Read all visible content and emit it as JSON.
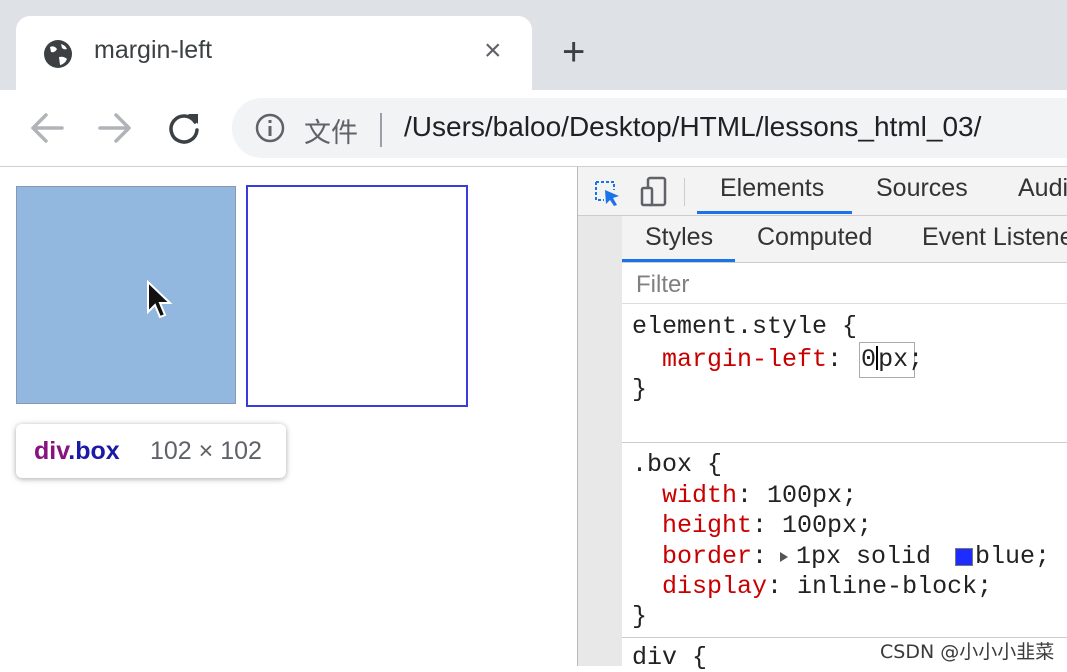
{
  "browser": {
    "tab_title": "margin-left",
    "close_tab_glyph": "×",
    "new_tab_glyph": "+",
    "file_label": "文件",
    "url": "/Users/baloo/Desktop/HTML/lessons_html_03/"
  },
  "page": {
    "tooltip_selector_tag": "div",
    "tooltip_selector_class": ".box",
    "tooltip_dimensions": "102 × 102"
  },
  "devtools": {
    "tabs": [
      "Elements",
      "Sources",
      "Audi"
    ],
    "active_tab": "Elements",
    "subtabs": [
      "Styles",
      "Computed",
      "Event Listene"
    ],
    "active_subtab": "Styles",
    "filter_placeholder": "Filter",
    "rules": [
      {
        "selector": "element.style {",
        "declarations": [
          {
            "prop": "margin-left",
            "value_before_caret": "0",
            "value_after_caret": "px"
          }
        ],
        "close": "}"
      },
      {
        "selector": ".box {",
        "declarations": [
          {
            "prop": "width",
            "value": "100px;"
          },
          {
            "prop": "height",
            "value": "100px;"
          },
          {
            "prop": "border",
            "value": "1px solid ",
            "color_name": "blue",
            "end": ";"
          },
          {
            "prop": "display",
            "value": "inline-block;"
          }
        ],
        "close": "}"
      },
      {
        "selector": "div {"
      }
    ]
  },
  "watermark": "CSDN @小小小韭菜",
  "colors": {
    "box_fill": "#93b8e0",
    "box_border": "#3b3bdd",
    "accent_blue": "#1a73e8",
    "property_red": "#c80000",
    "tooltip_tag": "#881280",
    "tooltip_class": "#1a1aa6",
    "swatch_blue": "#1d2cff"
  },
  "icons": [
    "globe-icon",
    "back-icon",
    "forward-icon",
    "reload-icon",
    "info-icon",
    "inspect-element-icon",
    "device-toolbar-icon",
    "mouse-pointer-icon",
    "expand-triangle-icon"
  ]
}
